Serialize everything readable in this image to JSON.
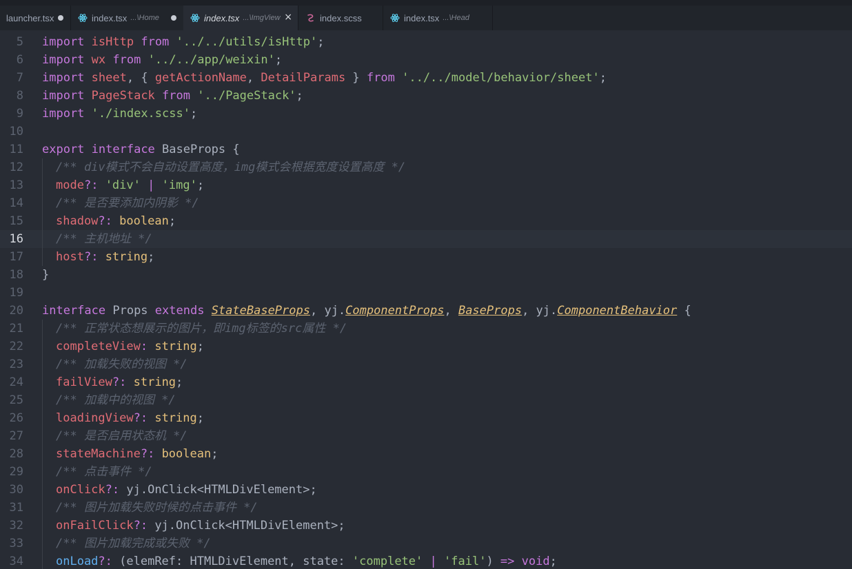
{
  "tabs": [
    {
      "icon": "none",
      "label": "launcher.tsx",
      "desc": "",
      "state": "dirty"
    },
    {
      "icon": "react",
      "label": "index.tsx",
      "desc": "...\\Home",
      "state": "dirty"
    },
    {
      "icon": "react",
      "label": "index.tsx",
      "desc": "...\\ImgView",
      "state": "active"
    },
    {
      "icon": "sass",
      "label": "index.scss",
      "desc": "",
      "state": ""
    },
    {
      "icon": "react",
      "label": "index.tsx",
      "desc": "...\\Head",
      "state": ""
    }
  ],
  "tab_close_glyph": "×",
  "current_line": 16,
  "colors": {
    "keyword": "#c678dd",
    "string": "#98c379",
    "variable": "#e06c75",
    "type": "#e5c07b",
    "comment": "#5c6370",
    "cyan": "#56b6c2",
    "function": "#61afef",
    "plain": "#abb2bf",
    "background": "#282c34",
    "tabbar": "#21252b",
    "react_icon": "#61dafb",
    "sass_icon": "#cd6799"
  },
  "lines": [
    {
      "n": "5",
      "indent": false,
      "t": [
        [
          "k",
          "import"
        ],
        [
          "p",
          " "
        ],
        [
          "v",
          "isHttp"
        ],
        [
          "p",
          " "
        ],
        [
          "k",
          "from"
        ],
        [
          "p",
          " "
        ],
        [
          "s",
          "'../../utils/isHttp'"
        ],
        [
          "p",
          ";"
        ]
      ]
    },
    {
      "n": "6",
      "indent": false,
      "t": [
        [
          "k",
          "import"
        ],
        [
          "p",
          " "
        ],
        [
          "v",
          "wx"
        ],
        [
          "p",
          " "
        ],
        [
          "k",
          "from"
        ],
        [
          "p",
          " "
        ],
        [
          "s",
          "'../../app/weixin'"
        ],
        [
          "p",
          ";"
        ]
      ]
    },
    {
      "n": "7",
      "indent": false,
      "t": [
        [
          "k",
          "import"
        ],
        [
          "p",
          " "
        ],
        [
          "v",
          "sheet"
        ],
        [
          "p",
          ", { "
        ],
        [
          "v",
          "getActionName"
        ],
        [
          "p",
          ", "
        ],
        [
          "v",
          "DetailParams"
        ],
        [
          "p",
          " } "
        ],
        [
          "k",
          "from"
        ],
        [
          "p",
          " "
        ],
        [
          "s",
          "'../../model/behavior/sheet'"
        ],
        [
          "p",
          ";"
        ]
      ]
    },
    {
      "n": "8",
      "indent": false,
      "t": [
        [
          "k",
          "import"
        ],
        [
          "p",
          " "
        ],
        [
          "v",
          "PageStack"
        ],
        [
          "p",
          " "
        ],
        [
          "k",
          "from"
        ],
        [
          "p",
          " "
        ],
        [
          "s",
          "'../PageStack'"
        ],
        [
          "p",
          ";"
        ]
      ]
    },
    {
      "n": "9",
      "indent": false,
      "t": [
        [
          "k",
          "import"
        ],
        [
          "p",
          " "
        ],
        [
          "s",
          "'./index.scss'"
        ],
        [
          "p",
          ";"
        ]
      ]
    },
    {
      "n": "10",
      "indent": false,
      "t": []
    },
    {
      "n": "11",
      "indent": false,
      "t": [
        [
          "k",
          "export"
        ],
        [
          "p",
          " "
        ],
        [
          "k",
          "interface"
        ],
        [
          "p",
          " BaseProps {"
        ]
      ]
    },
    {
      "n": "12",
      "indent": true,
      "t": [
        [
          "c",
          "/** div模式不会自动设置高度，img模式会根据宽度设置高度 */"
        ]
      ]
    },
    {
      "n": "13",
      "indent": true,
      "t": [
        [
          "v",
          "mode"
        ],
        [
          "k",
          "?:"
        ],
        [
          "p",
          " "
        ],
        [
          "s",
          "'div'"
        ],
        [
          "p",
          " "
        ],
        [
          "k",
          "|"
        ],
        [
          "p",
          " "
        ],
        [
          "s",
          "'img'"
        ],
        [
          "p",
          ";"
        ]
      ]
    },
    {
      "n": "14",
      "indent": true,
      "t": [
        [
          "c",
          "/** 是否要添加内阴影 */"
        ]
      ]
    },
    {
      "n": "15",
      "indent": true,
      "t": [
        [
          "v",
          "shadow"
        ],
        [
          "k",
          "?:"
        ],
        [
          "p",
          " "
        ],
        [
          "t",
          "boolean"
        ],
        [
          "p",
          ";"
        ]
      ]
    },
    {
      "n": "16",
      "indent": true,
      "t": [
        [
          "c",
          "/** 主机地址 */"
        ]
      ]
    },
    {
      "n": "17",
      "indent": true,
      "t": [
        [
          "v",
          "host"
        ],
        [
          "k",
          "?:"
        ],
        [
          "p",
          " "
        ],
        [
          "t",
          "string"
        ],
        [
          "p",
          ";"
        ]
      ]
    },
    {
      "n": "18",
      "indent": false,
      "t": [
        [
          "p",
          "}"
        ]
      ]
    },
    {
      "n": "19",
      "indent": false,
      "t": []
    },
    {
      "n": "20",
      "indent": false,
      "t": [
        [
          "k",
          "interface"
        ],
        [
          "p",
          " Props "
        ],
        [
          "k",
          "extends"
        ],
        [
          "p",
          " "
        ],
        [
          "u",
          "StateBaseProps"
        ],
        [
          "p",
          ", yj."
        ],
        [
          "u",
          "ComponentProps"
        ],
        [
          "p",
          ", "
        ],
        [
          "u",
          "BaseProps"
        ],
        [
          "p",
          ", yj."
        ],
        [
          "u",
          "ComponentBehavior"
        ],
        [
          "p",
          " {"
        ]
      ]
    },
    {
      "n": "21",
      "indent": true,
      "t": [
        [
          "c",
          "/** 正常状态想展示的图片，即img标签的src属性 */"
        ]
      ]
    },
    {
      "n": "22",
      "indent": true,
      "t": [
        [
          "v",
          "completeView"
        ],
        [
          "k",
          ":"
        ],
        [
          "p",
          " "
        ],
        [
          "t",
          "string"
        ],
        [
          "p",
          ";"
        ]
      ]
    },
    {
      "n": "23",
      "indent": true,
      "t": [
        [
          "c",
          "/** 加载失败的视图 */"
        ]
      ]
    },
    {
      "n": "24",
      "indent": true,
      "t": [
        [
          "v",
          "failView"
        ],
        [
          "k",
          "?:"
        ],
        [
          "p",
          " "
        ],
        [
          "t",
          "string"
        ],
        [
          "p",
          ";"
        ]
      ]
    },
    {
      "n": "25",
      "indent": true,
      "t": [
        [
          "c",
          "/** 加载中的视图 */"
        ]
      ]
    },
    {
      "n": "26",
      "indent": true,
      "t": [
        [
          "v",
          "loadingView"
        ],
        [
          "k",
          "?:"
        ],
        [
          "p",
          " "
        ],
        [
          "t",
          "string"
        ],
        [
          "p",
          ";"
        ]
      ]
    },
    {
      "n": "27",
      "indent": true,
      "t": [
        [
          "c",
          "/** 是否启用状态机 */"
        ]
      ]
    },
    {
      "n": "28",
      "indent": true,
      "t": [
        [
          "v",
          "stateMachine"
        ],
        [
          "k",
          "?:"
        ],
        [
          "p",
          " "
        ],
        [
          "t",
          "boolean"
        ],
        [
          "p",
          ";"
        ]
      ]
    },
    {
      "n": "29",
      "indent": true,
      "t": [
        [
          "c",
          "/** 点击事件 */"
        ]
      ]
    },
    {
      "n": "30",
      "indent": true,
      "t": [
        [
          "v",
          "onClick"
        ],
        [
          "k",
          "?:"
        ],
        [
          "p",
          " yj.OnClick<HTMLDivElement>;"
        ]
      ]
    },
    {
      "n": "31",
      "indent": true,
      "t": [
        [
          "c",
          "/** 图片加载失败时候的点击事件 */"
        ]
      ]
    },
    {
      "n": "32",
      "indent": true,
      "t": [
        [
          "v",
          "onFailClick"
        ],
        [
          "k",
          "?:"
        ],
        [
          "p",
          " yj.OnClick<HTMLDivElement>;"
        ]
      ]
    },
    {
      "n": "33",
      "indent": true,
      "t": [
        [
          "c",
          "/** 图片加载完成或失败 */"
        ]
      ]
    },
    {
      "n": "34",
      "indent": true,
      "t": [
        [
          "blue",
          "onLoad"
        ],
        [
          "k",
          "?:"
        ],
        [
          "p",
          " (elemRef: HTMLDivElement, state: "
        ],
        [
          "s",
          "'complete'"
        ],
        [
          "p",
          " "
        ],
        [
          "k",
          "|"
        ],
        [
          "p",
          " "
        ],
        [
          "s",
          "'fail'"
        ],
        [
          "p",
          ") "
        ],
        [
          "k",
          "=>"
        ],
        [
          "p",
          " "
        ],
        [
          "k",
          "void"
        ],
        [
          "p",
          ";"
        ]
      ]
    }
  ]
}
